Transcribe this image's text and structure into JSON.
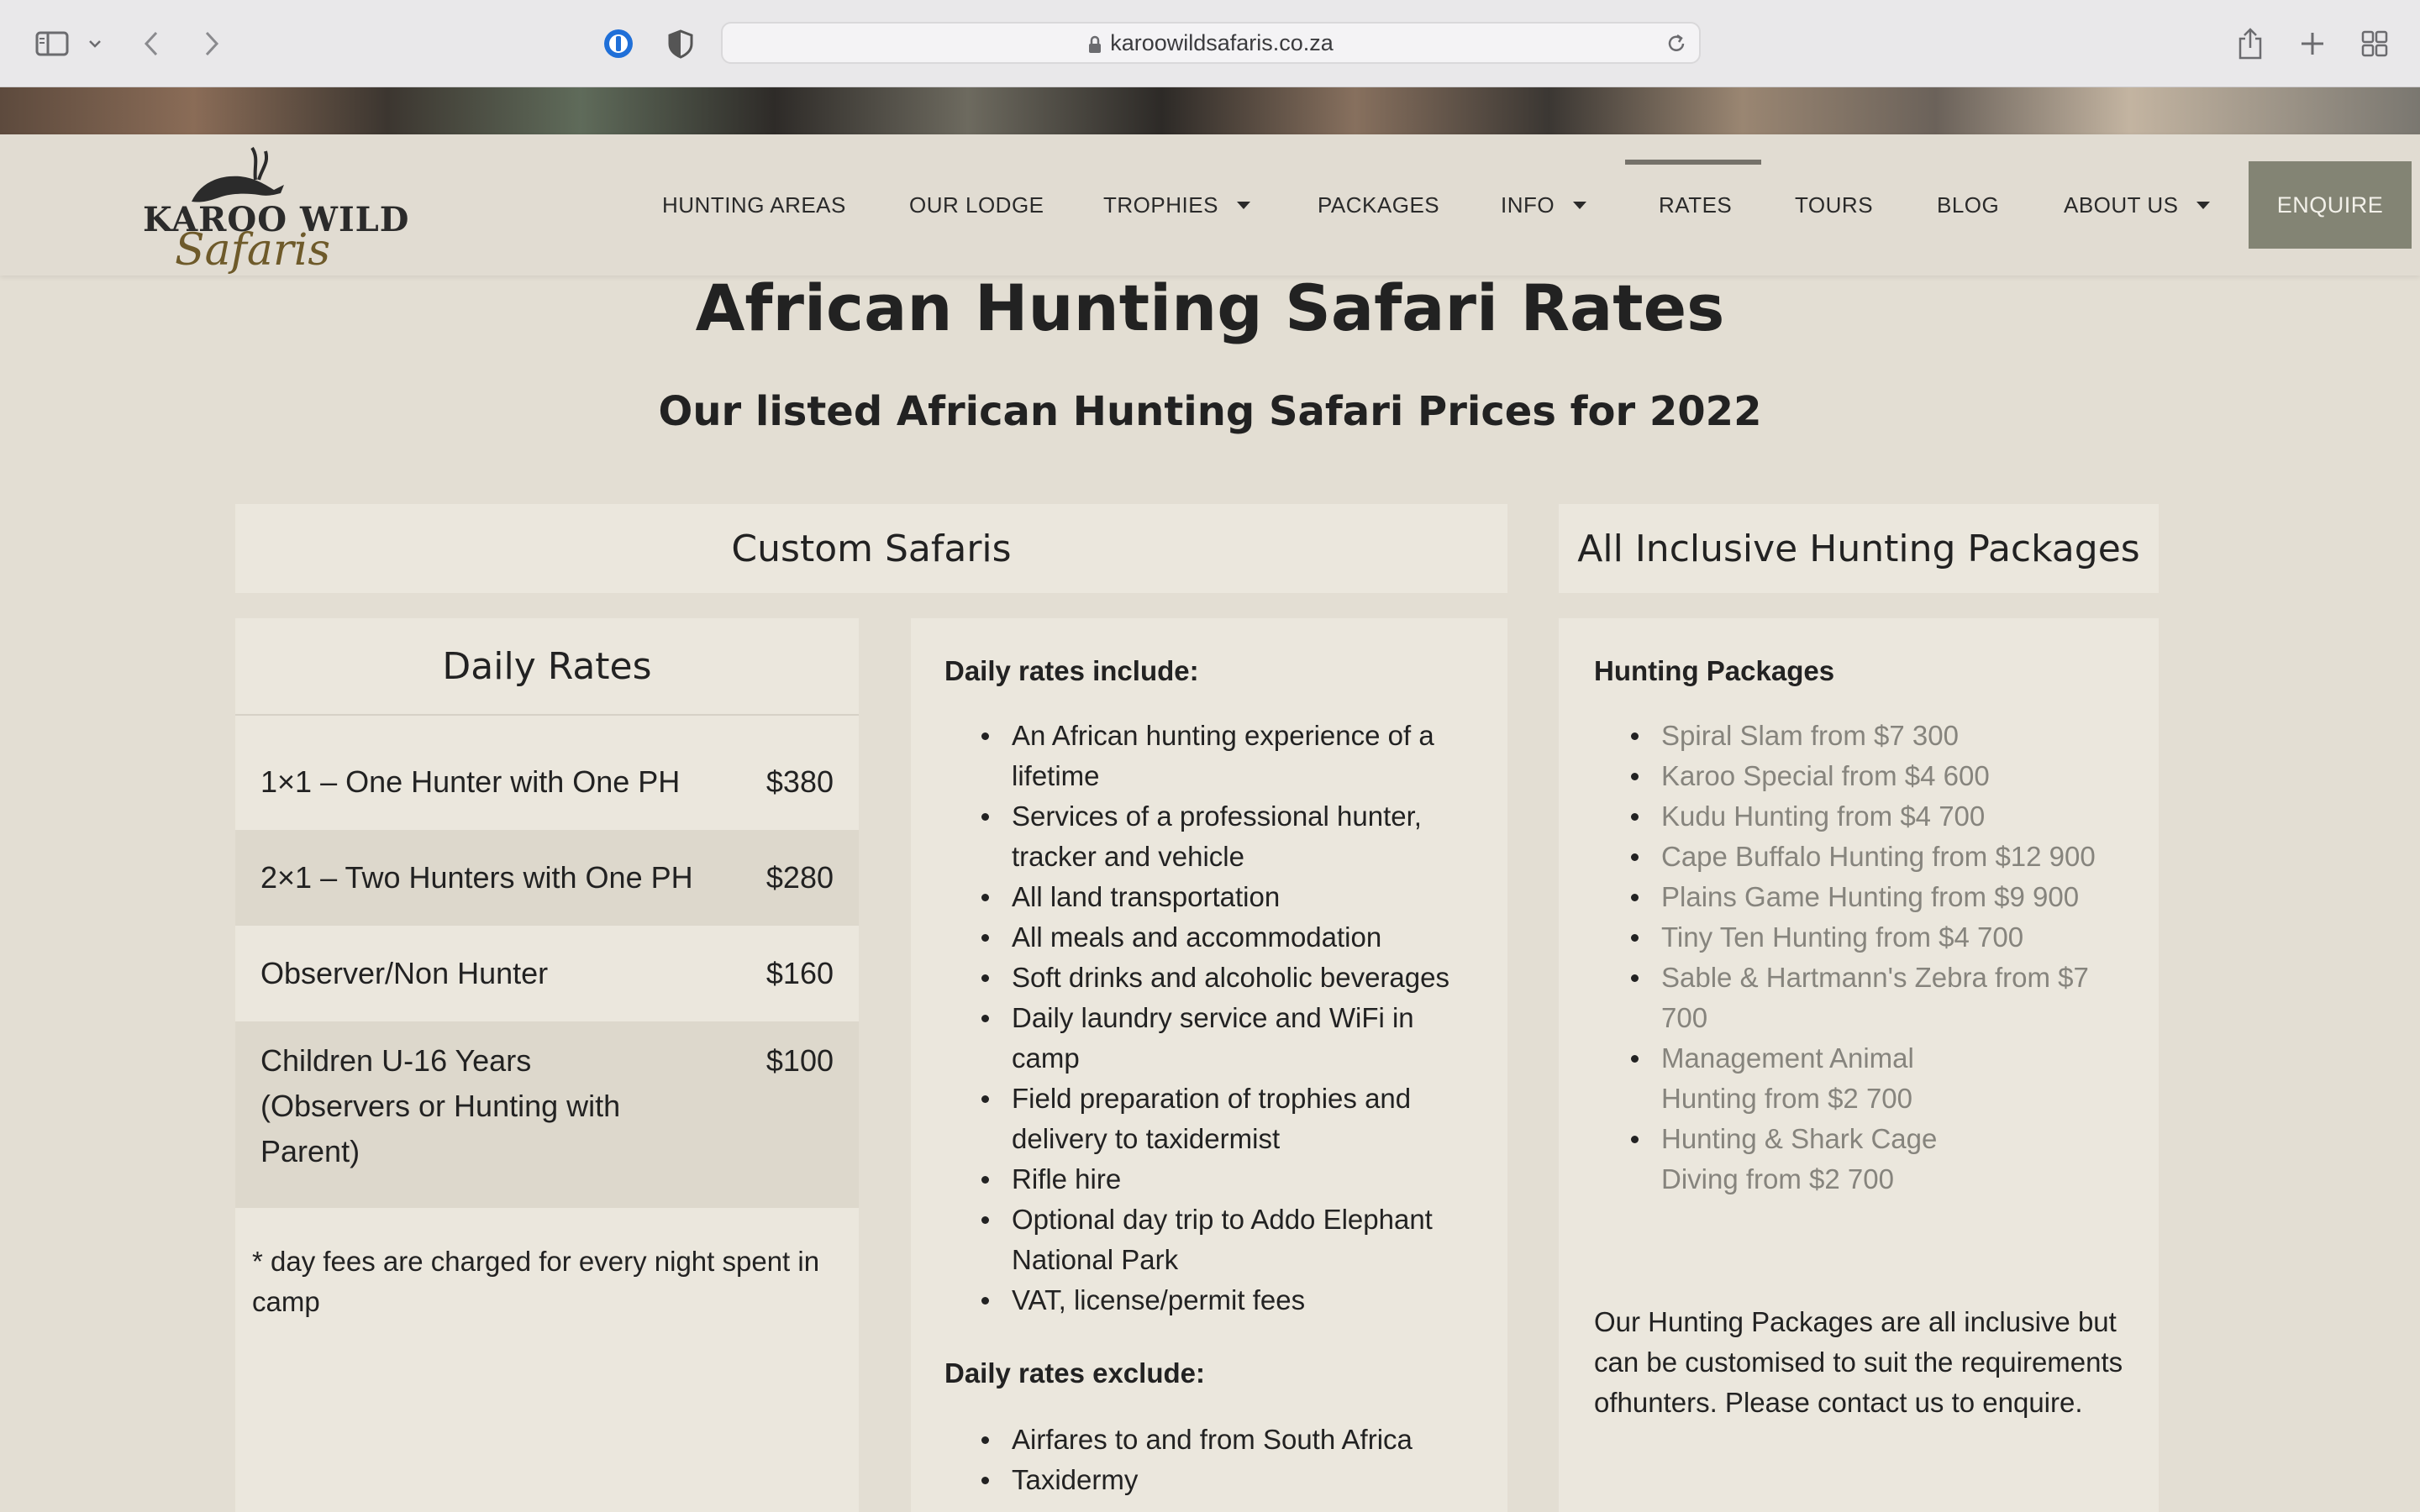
{
  "browser": {
    "url": "karoowildsafaris.co.za"
  },
  "logo": {
    "line1": "KAROO WILD",
    "line2": "Safaris"
  },
  "nav": {
    "items": [
      {
        "label": "HUNTING AREAS"
      },
      {
        "label": "OUR LODGE"
      },
      {
        "label": "TROPHIES"
      },
      {
        "label": "PACKAGES"
      },
      {
        "label": "INFO"
      },
      {
        "label": "RATES"
      },
      {
        "label": "TOURS"
      },
      {
        "label": "BLOG"
      },
      {
        "label": "ABOUT US"
      }
    ],
    "active": "RATES",
    "enquire": "ENQUIRE"
  },
  "page": {
    "title": "African Hunting Safari Rates",
    "subtitle": "Our listed African Hunting Safari Prices for 2022"
  },
  "custom": {
    "title": "Custom Safaris",
    "daily_rates_title": "Daily Rates",
    "rates": [
      {
        "name": "1×1 – One Hunter with One PH",
        "price": "$380"
      },
      {
        "name": "2×1 – Two Hunters with One PH",
        "price": "$280"
      },
      {
        "name": "Observer/Non Hunter",
        "price": "$160"
      },
      {
        "name": "Children U-16 Years (Observers or Hunting with Parent)",
        "price": "$100"
      }
    ],
    "note": "* day fees are charged for every night spent in camp",
    "include_heading": "Daily rates include:",
    "includes": [
      "An African hunting experience of a lifetime",
      "Services of a professional hunter, tracker and vehicle",
      "All land transportation",
      "All meals and accommodation",
      "Soft drinks and alcoholic beverages",
      "Daily laundry service and WiFi in camp",
      "Field preparation of trophies and delivery to taxidermist",
      "Rifle hire",
      "Optional day trip to Addo Elephant National Park",
      "VAT, license/permit fees"
    ],
    "exclude_heading": "Daily rates exclude:",
    "excludes": [
      "Airfares to and from South Africa",
      "Taxidermy"
    ]
  },
  "packages": {
    "title": "All Inclusive Hunting Packages",
    "heading": "Hunting Packages",
    "items": [
      "Spiral Slam from $7 300",
      "Karoo Special from $4 600",
      "Kudu Hunting from $4 700",
      "Cape Buffalo Hunting from $12 900",
      "Plains Game Hunting from $9 900",
      "Tiny Ten Hunting from $4 700",
      "Sable & Hartmann's Zebra from $7 700",
      "Management Animal Hunting from $2 700",
      "Hunting & Shark Cage Diving from $2 700"
    ],
    "note": "Our Hunting Packages are all inclusive but can be customised to suit the requirements ofhunters. Please contact us to enquire."
  }
}
